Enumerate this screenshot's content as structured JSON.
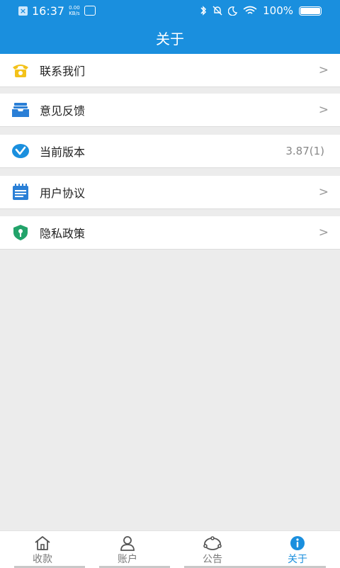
{
  "status_bar": {
    "time": "16:37",
    "net_speed_value": "0.00",
    "net_speed_unit": "KB/s",
    "battery": "100%"
  },
  "header": {
    "title": "关于"
  },
  "items": [
    {
      "label": "联系我们",
      "icon": "phone-icon",
      "icon_color": "#f3c21a"
    },
    {
      "label": "意见反馈",
      "icon": "feedback-tray-icon",
      "icon_color": "#2a7fd6"
    },
    {
      "label": "当前版本",
      "icon": "version-check-icon",
      "icon_color": "#1a8fde",
      "value": "3.87(1)"
    },
    {
      "label": "用户协议",
      "icon": "agreement-notepad-icon",
      "icon_color": "#2a7fd6"
    },
    {
      "label": "隐私政策",
      "icon": "privacy-shield-icon",
      "icon_color": "#22a36a"
    }
  ],
  "tabs": [
    {
      "label": "收款",
      "icon": "home-icon"
    },
    {
      "label": "账户",
      "icon": "user-icon"
    },
    {
      "label": "公告",
      "icon": "announcement-icon"
    },
    {
      "label": "关于",
      "icon": "info-icon",
      "active": true
    }
  ],
  "chevron": ">",
  "colors": {
    "primary": "#1a8fde",
    "background": "#ececec"
  }
}
